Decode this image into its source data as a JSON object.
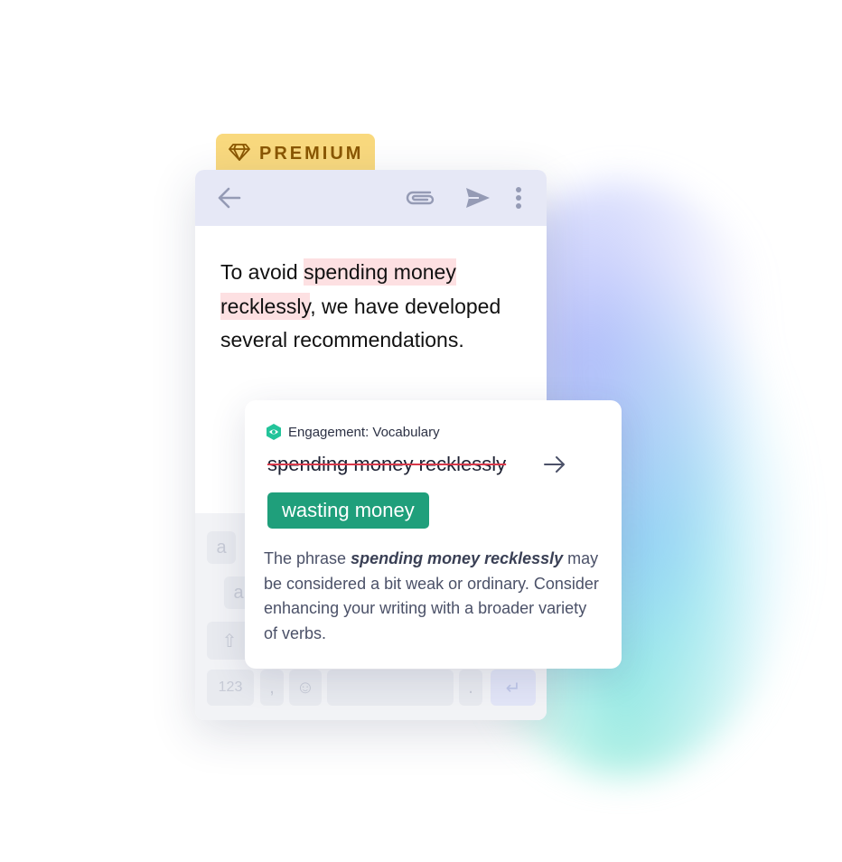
{
  "badge": {
    "label": "PREMIUM",
    "icon": "diamond-icon"
  },
  "toolbar": {
    "icons": [
      "arrow-left-icon",
      "paperclip-icon",
      "send-icon",
      "more-vertical-icon"
    ]
  },
  "editor": {
    "text_before": "To avoid ",
    "highlight_1": "spending money",
    "highlight_2": "recklessly",
    "text_after": ", we have developed several recommendations."
  },
  "keyboard": {
    "keys": {
      "a1": "a",
      "a2": "a",
      "shift": "⇧",
      "numbers": "123",
      "comma": ",",
      "emoji": "☺",
      "period": ".",
      "enter": "↵"
    }
  },
  "suggestion": {
    "category": "Engagement: Vocabulary",
    "original": "spending money recklessly",
    "replacement": "wasting money",
    "explanation_prefix": "The phrase ",
    "explanation_emphasis": "spending money recklessly",
    "explanation_rest": " may be considered a bit weak or ordinary. Consider enhancing your writing with a broader variety of verbs."
  },
  "colors": {
    "accent_green": "#1f9f7b",
    "badge_yellow": "#f9d97e",
    "highlight_pink": "#fde0e2",
    "strike_red": "#d8394a"
  }
}
